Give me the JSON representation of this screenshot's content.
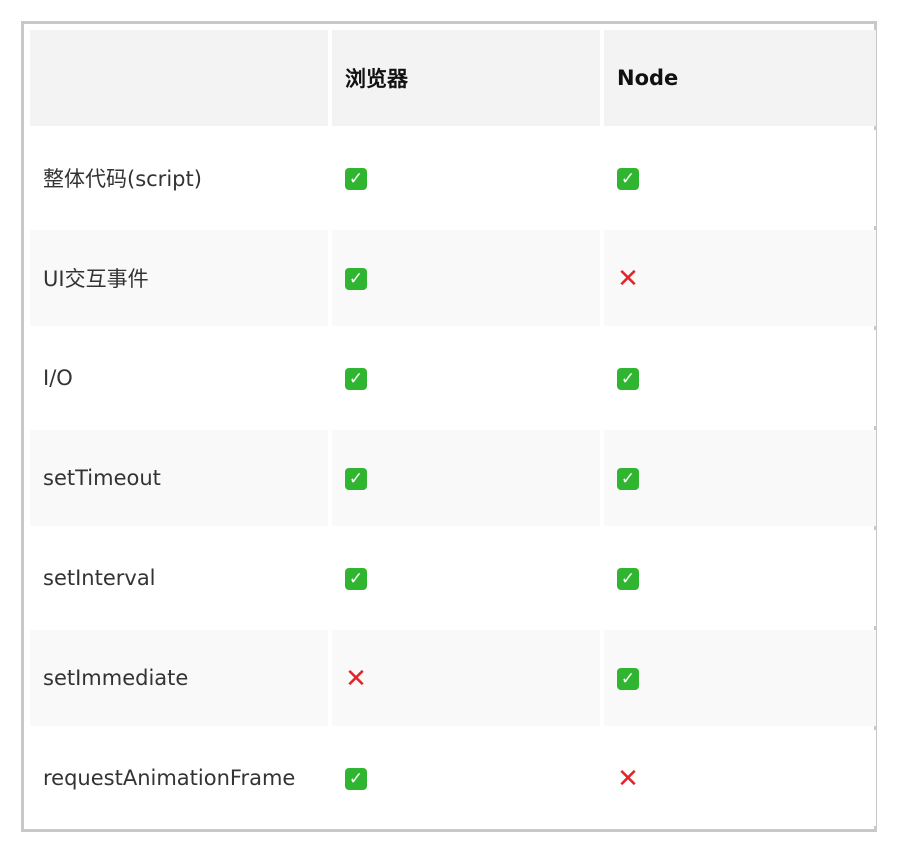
{
  "table": {
    "headers": [
      "",
      "浏览器",
      "Node"
    ],
    "rows": [
      {
        "name": "整体代码(script)",
        "browser": "yes",
        "node": "yes"
      },
      {
        "name": "UI交互事件",
        "browser": "yes",
        "node": "no"
      },
      {
        "name": "I/O",
        "browser": "yes",
        "node": "yes"
      },
      {
        "name": "setTimeout",
        "browser": "yes",
        "node": "yes"
      },
      {
        "name": "setInterval",
        "browser": "yes",
        "node": "yes"
      },
      {
        "name": "setImmediate",
        "browser": "no",
        "node": "yes"
      },
      {
        "name": "requestAnimationFrame",
        "browser": "yes",
        "node": "no"
      }
    ]
  },
  "marks": {
    "yes": {
      "glyph": "✓",
      "icon": "check-mark-button-icon",
      "color": "#2fb52f"
    },
    "no": {
      "glyph": "✕",
      "icon": "cross-mark-icon",
      "color": "#e0262b"
    }
  }
}
